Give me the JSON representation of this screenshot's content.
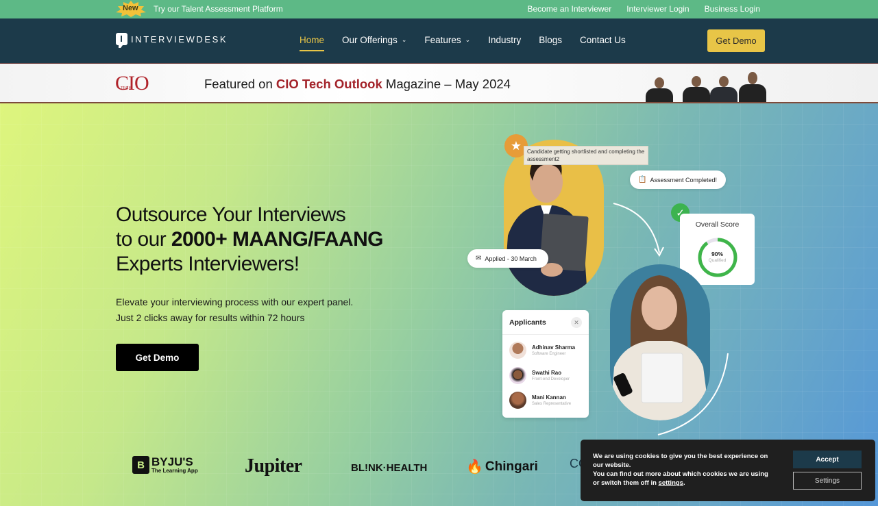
{
  "topbar": {
    "badge": "New",
    "promo": "Try our Talent Assessment Platform",
    "links": [
      "Become an Interviewer",
      "Interviewer Login",
      "Business Login"
    ]
  },
  "nav": {
    "logo_text": "INTERVIEWDESK",
    "items": [
      {
        "label": "Home",
        "active": true,
        "dropdown": false
      },
      {
        "label": "Our Offerings",
        "active": false,
        "dropdown": true
      },
      {
        "label": "Features",
        "active": false,
        "dropdown": true
      },
      {
        "label": "Industry",
        "active": false,
        "dropdown": false
      },
      {
        "label": "Blogs",
        "active": false,
        "dropdown": false
      },
      {
        "label": "Contact Us",
        "active": false,
        "dropdown": false
      }
    ],
    "cta": "Get Demo",
    "accent": "#e8c547"
  },
  "featured": {
    "cio_logo": "CIO",
    "cio_small": "TECH",
    "prefix": "Featured on ",
    "highlight": "CIO Tech Outlook",
    "suffix": " Magazine – May 2024"
  },
  "hero": {
    "title_line1": "Outsource Your Interviews",
    "title_line2_prefix": "to our ",
    "title_line2_bold": "2000+ MAANG/FAANG",
    "title_line3": "Experts Interviewers!",
    "sub_line1": "Elevate your interviewing process with our expert panel.",
    "sub_line2": "Just 2 clicks away for results within 72 hours",
    "cta": "Get Demo"
  },
  "illustration": {
    "tooltip": "Candidate getting shortlisted and completing the assessment2",
    "assessment_pill": "Assessment Completed!",
    "applied_pill": "Applied - 30 March",
    "score": {
      "title": "Overall Score",
      "percent_label": "90%",
      "percent_value": 90,
      "status": "Qualified"
    },
    "applicants": {
      "title": "Applicants",
      "list": [
        {
          "name": "Adhinav Sharma",
          "role": "Software Engineer"
        },
        {
          "name": "Swathi Rao",
          "role": "Front-end Developer"
        },
        {
          "name": "Mani Kannan",
          "role": "Sales Representative"
        }
      ]
    }
  },
  "logos": {
    "byjus": "BYJU'S",
    "byjus_tag": "The Learning App",
    "jupiter": "Jupiter",
    "blink": "BL!NK·HEALTH",
    "chingari": "Chingari",
    "partial": "CO"
  },
  "cookie": {
    "line1": "We are using cookies to give you the best experience on our website.",
    "line2_prefix": "You can find out more about which cookies we are using or switch them off in ",
    "link": "settings",
    "line2_suffix": ".",
    "accept": "Accept",
    "settings": "Settings"
  }
}
